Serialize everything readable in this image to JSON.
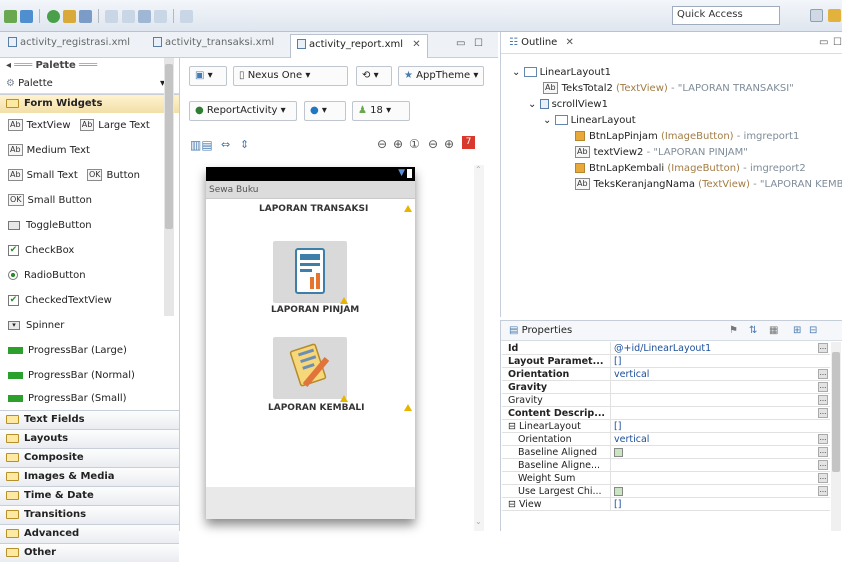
{
  "toolbar": {
    "quick_access": "Quick Access"
  },
  "tabs": [
    {
      "label": "activity_registrasi.xml"
    },
    {
      "label": "activity_transaksi.xml"
    },
    {
      "label": "activity_report.xml"
    }
  ],
  "palette": {
    "title": "Palette",
    "header": "Palette",
    "form_widgets": "Form Widgets",
    "items": {
      "textview": "TextView",
      "large_text": "Large Text",
      "medium_text": "Medium Text",
      "small_text": "Small Text",
      "button": "Button",
      "small_button": "Small Button",
      "togglebutton": "ToggleButton",
      "checkbox": "CheckBox",
      "radiobutton": "RadioButton",
      "checkedtextview": "CheckedTextView",
      "spinner": "Spinner",
      "pb_large": "ProgressBar (Large)",
      "pb_normal": "ProgressBar (Normal)",
      "pb_small": "ProgressBar (Small)"
    },
    "categories": [
      "Text Fields",
      "Layouts",
      "Composite",
      "Images & Media",
      "Time & Date",
      "Transitions",
      "Advanced",
      "Other"
    ]
  },
  "canvas": {
    "device": "Nexus One",
    "theme": "AppTheme",
    "activity": "ReportActivity",
    "api": "18",
    "screen": {
      "app_title": "Sewa Buku",
      "heading": "LAPORAN TRANSAKSI",
      "label1": "LAPORAN PINJAM",
      "label2": "LAPORAN KEMBALI"
    }
  },
  "outline": {
    "title": "Outline",
    "nodes": {
      "root": "LinearLayout1",
      "n1_name": "TeksTotal2",
      "n1_type": "(TextView)",
      "n1_val": "- \"LAPORAN TRANSAKSI\"",
      "scroll": "scrollView1",
      "inner": "LinearLayout",
      "n2_name": "BtnLapPinjam",
      "n2_type": "(ImageButton)",
      "n2_val": "- imgreport1",
      "n3_name": "textView2",
      "n3_val": "- \"LAPORAN PINJAM\"",
      "n4_name": "BtnLapKembali",
      "n4_type": "(ImageButton)",
      "n4_val": "- imgreport2",
      "n5_name": "TeksKeranjangNama",
      "n5_type": "(TextView)",
      "n5_val": "- \"LAPORAN KEMBALI\""
    }
  },
  "properties": {
    "title": "Properties",
    "rows": [
      {
        "key": "Id",
        "val": "@+id/LinearLayout1"
      },
      {
        "key": "Layout Paramet...",
        "val": "[]"
      },
      {
        "key": "Orientation",
        "val": "vertical"
      },
      {
        "key": "Gravity",
        "val": ""
      },
      {
        "key": "Gravity",
        "val": ""
      },
      {
        "key": "Content Descrip...",
        "val": ""
      },
      {
        "key": "LinearLayout",
        "val": "[]"
      },
      {
        "key": "Orientation",
        "val": "vertical"
      },
      {
        "key": "Baseline Aligned",
        "val": ""
      },
      {
        "key": "Baseline Aligne...",
        "val": ""
      },
      {
        "key": "Weight Sum",
        "val": ""
      },
      {
        "key": "Use Largest Chi...",
        "val": ""
      },
      {
        "key": "View",
        "val": "[]"
      }
    ]
  }
}
